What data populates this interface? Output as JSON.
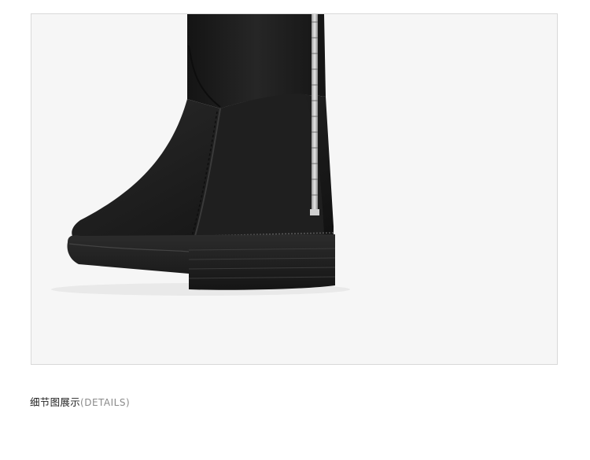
{
  "caption": {
    "zh": "细节图展示",
    "en": "(DETAILS)"
  },
  "photo": {
    "subject": "boot-heel-detail-photo",
    "background_color": "#f6f6f6",
    "boot_color": "#1c1c1c"
  }
}
